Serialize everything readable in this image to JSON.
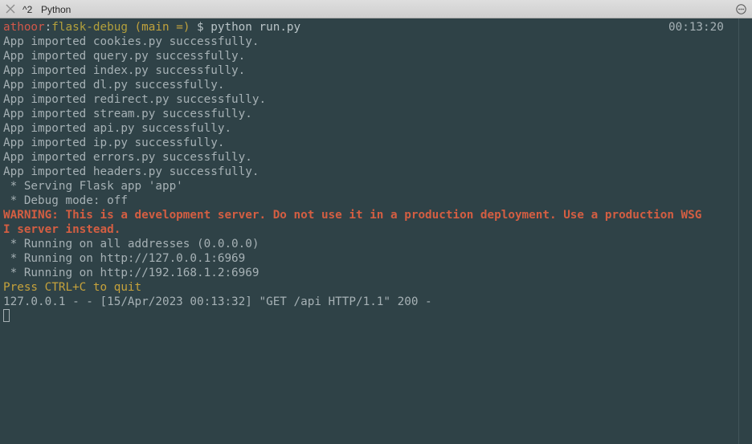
{
  "window": {
    "shortcut": "^2",
    "tab_title": "Python"
  },
  "colors": {
    "background": "#2f4247",
    "text": "#a6b1b5",
    "prompt_user": "#d2584a",
    "prompt_dir": "#b3a03c",
    "warning": "#d45e42",
    "press_ctrl": "#c6a23b"
  },
  "prompt": {
    "user": "athoor",
    "separator": ":",
    "directory": "flask-debug",
    "branch": " (main =)",
    "symbol": " $ ",
    "command": "python run.py",
    "time": "00:13:20"
  },
  "output": [
    "App imported cookies.py successfully.",
    "App imported query.py successfully.",
    "App imported index.py successfully.",
    "App imported dl.py successfully.",
    "App imported redirect.py successfully.",
    "App imported stream.py successfully.",
    "App imported api.py successfully.",
    "App imported ip.py successfully.",
    "App imported errors.py successfully.",
    "App imported headers.py successfully.",
    " * Serving Flask app 'app'",
    " * Debug mode: off"
  ],
  "warning": [
    "WARNING: This is a development server. Do not use it in a production deployment. Use a production WSG",
    "I server instead."
  ],
  "running": [
    " * Running on all addresses (0.0.0.0)",
    " * Running on http://127.0.0.1:6969",
    " * Running on http://192.168.1.2:6969"
  ],
  "quit_hint": "Press CTRL+C to quit",
  "request_log": "127.0.0.1 - - [15/Apr/2023 00:13:32] \"GET /api HTTP/1.1\" 200 -"
}
